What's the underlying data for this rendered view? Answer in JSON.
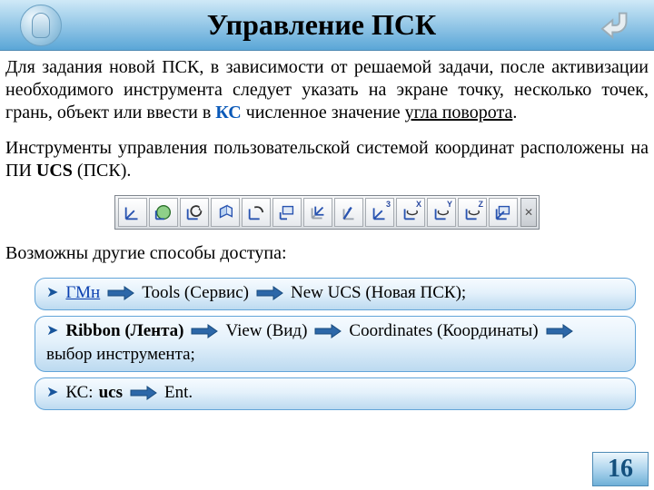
{
  "header": {
    "title": "Управление ПСК"
  },
  "text": {
    "p1_a": "Для задания новой ПСК, в зависимости от решаемой задачи, после активизации необходимого инструмента следует указать на экране точку, несколько точек, грань, объект или ввести в ",
    "p1_kc": "КС",
    "p1_b": " численное значение ",
    "p1_u": "угла поворота",
    "p1_c": ".",
    "p2_a": "Инструменты управления пользовательской системой координат расположены на ПИ ",
    "p2_b": "UCS",
    "p2_c": " (ПСК).",
    "p3": "Возможны другие способы доступа:"
  },
  "toolbar_icons": [
    "ucs-axes-icon",
    "ucs-world-icon",
    "ucs-prev-icon",
    "ucs-face-icon",
    "ucs-object-icon",
    "ucs-view-icon",
    "ucs-origin-icon",
    "ucs-zaxis-icon",
    "ucs-3point-icon",
    "ucs-rotate-x-icon",
    "ucs-rotate-y-icon",
    "ucs-rotate-z-icon",
    "ucs-apply-icon"
  ],
  "rot_labels": {
    "x": "X",
    "y": "Y",
    "z": "Z",
    "three": "3"
  },
  "paths": {
    "r1": {
      "gmn": "ГМн",
      "tools": "Tools (Сервис)",
      "newucs": "New UCS (Новая ПСК);"
    },
    "r2": {
      "ribbon": "Ribbon (Лента)",
      "view": "View (Вид)",
      "coords": "Coordinates (Координаты)",
      "tail": "выбор инструмента;"
    },
    "r3": {
      "kc": "КС: ",
      "cmd": "ucs",
      "ent": "Ent."
    }
  },
  "page_number": "16"
}
